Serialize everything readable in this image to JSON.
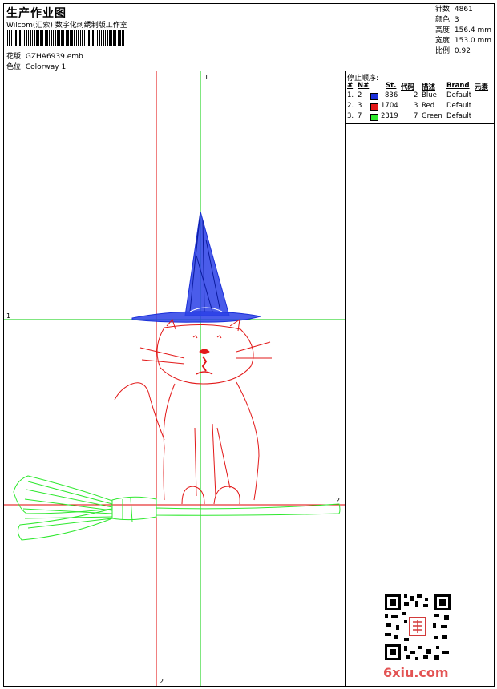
{
  "header": {
    "title": "生产作业图",
    "subtitle": "Wilcom(汇索) 数字化刺绣制版工作室",
    "filename": "花版:  GZHA6939.emb",
    "colorway": "色位:  Colorway 1"
  },
  "stats": {
    "stitches": "针数:  4861",
    "colors": "颜色:  3",
    "height": "高度:  156.4 mm",
    "width": "宽度:  153.0 mm",
    "scale": "比例:  0.92"
  },
  "guides": {
    "vertical_top": "1",
    "vertical_bottom": "2",
    "horizontal_left": "1",
    "horizontal_right": "2"
  },
  "stop_sequence": {
    "title": "停止顺序:",
    "headers": [
      "#",
      "N#",
      "St.",
      "代码",
      "描述",
      "Brand",
      "元素"
    ],
    "rows": [
      {
        "idx": "1.",
        "n": "2",
        "color": "#1a2fd8",
        "st": "836",
        "code": "2",
        "desc": "Blue",
        "brand": "Default"
      },
      {
        "idx": "2.",
        "n": "3",
        "color": "#e21818",
        "st": "1704",
        "code": "3",
        "desc": "Red",
        "brand": "Default"
      },
      {
        "idx": "3.",
        "n": "7",
        "color": "#2ee82e",
        "st": "2319",
        "code": "7",
        "desc": "Green",
        "brand": "Default"
      }
    ]
  },
  "watermark": {
    "text": "6xiu.com",
    "stamp": "红印"
  },
  "colors": {
    "guide_red": "#e00000",
    "guide_green": "#00cc00",
    "blue": "#1a2fd8",
    "red": "#e21818",
    "green": "#2ee82e"
  }
}
